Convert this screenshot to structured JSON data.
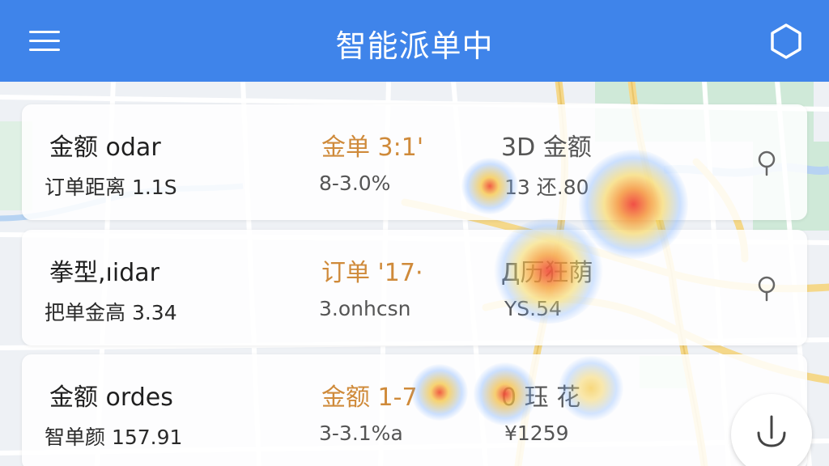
{
  "header": {
    "title": "智能派单中",
    "menu_icon": "hamburger-menu-icon",
    "action_icon": "hexagon-shield-icon",
    "background_color": "#3f84ea"
  },
  "orders": [
    {
      "title": "金额 odar",
      "subtitle": "订单距离 1.1S",
      "mid_title": "金单 3:1'",
      "mid_sub": "8-3.0%",
      "right_title": "3D 金额",
      "right_sub": "13 还.80",
      "pin_icon": "location-pin-icon"
    },
    {
      "title": "拳型,ıidar",
      "subtitle": "把单金高 3.34",
      "mid_title": "订单 '17·",
      "mid_sub": "3.onhcsn",
      "right_title": "Д历狂荫",
      "right_sub": "YS.54",
      "pin_icon": "location-pin-icon"
    },
    {
      "title": "金额 ordes",
      "subtitle": "智单颜 157.91",
      "mid_title": "金额 1-7",
      "mid_sub": "3-3.1%a",
      "right_title": "0 珏 花",
      "right_sub": "¥1259",
      "pin_icon": ""
    }
  ],
  "fab": {
    "icon": "download-arrow-icon"
  },
  "colors": {
    "accent_text": "#cf8a3a",
    "heat_hot": "#f0553a",
    "heat_warm": "#f5c542",
    "heat_cool": "#6ea8ff"
  }
}
